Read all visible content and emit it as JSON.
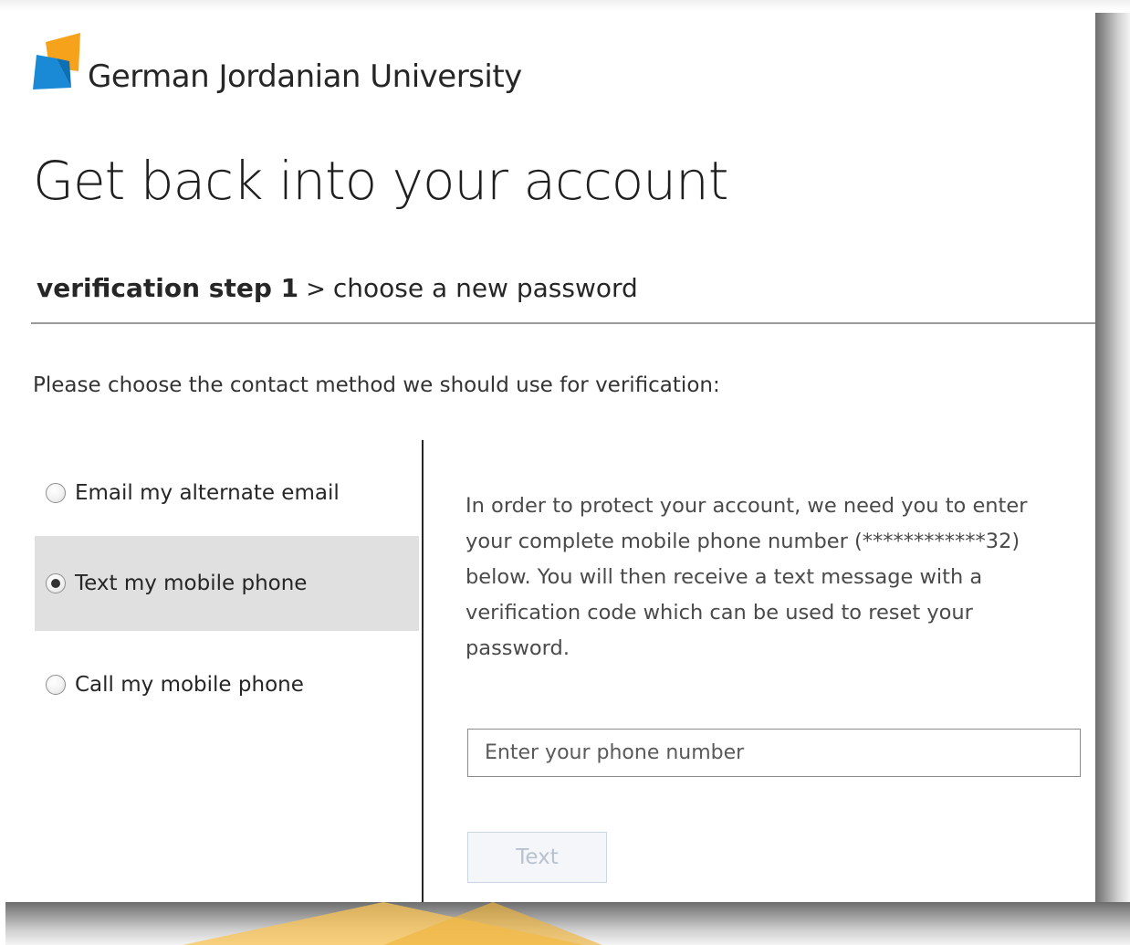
{
  "header": {
    "org_name": "German Jordanian University",
    "logo_colors": {
      "orange": "#f7a21b",
      "blue": "#1a8ad6"
    }
  },
  "page_title": "Get back into your account",
  "steps": {
    "current": "verification step 1",
    "separator": ">",
    "next": "choose a new password"
  },
  "instruction": "Please choose the contact method we should use for verification:",
  "options": [
    {
      "label": "Email my alternate email",
      "selected": false
    },
    {
      "label": "Text my mobile phone",
      "selected": true
    },
    {
      "label": "Call my mobile phone",
      "selected": false
    }
  ],
  "description": "In order to protect your account, we need you to enter your complete mobile phone number (************32) below. You will then receive a text message with a verification code which can be used to reset your password.",
  "phone_input": {
    "placeholder": "Enter your phone number",
    "value": ""
  },
  "text_button": {
    "label": "Text",
    "enabled": false
  }
}
